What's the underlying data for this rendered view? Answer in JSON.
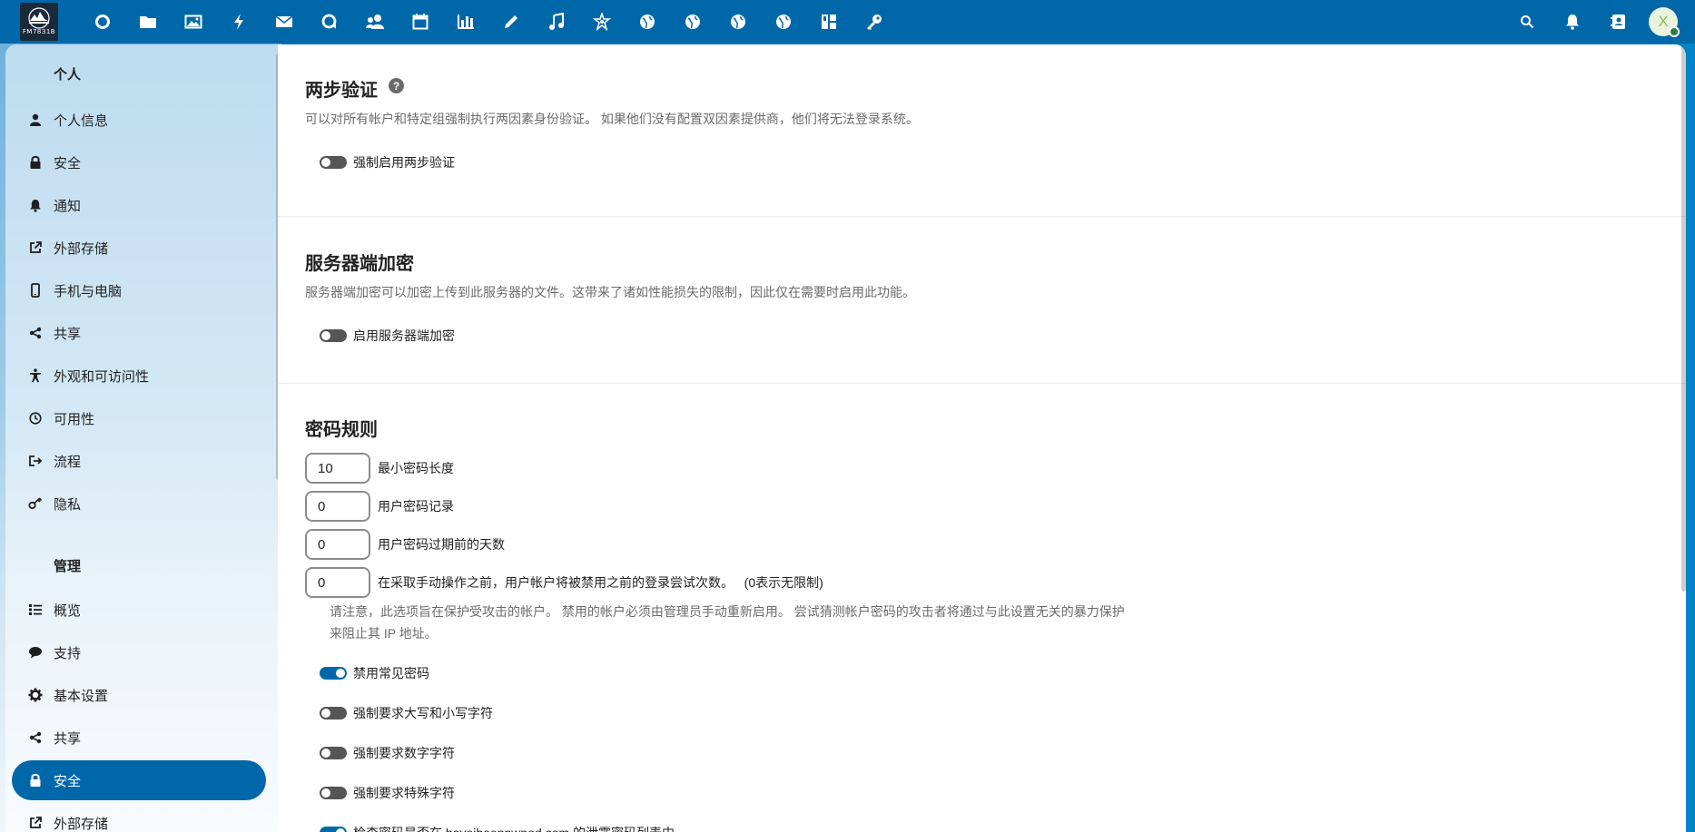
{
  "logo": {
    "text": "FM7831B"
  },
  "topbar": {
    "apps": [
      {
        "icon": "dashboard-icon",
        "glyph": "circle"
      },
      {
        "icon": "files-icon",
        "glyph": "folder"
      },
      {
        "icon": "photos-icon",
        "glyph": "image"
      },
      {
        "icon": "activity-icon",
        "glyph": "bolt"
      },
      {
        "icon": "mail-icon",
        "glyph": "mail"
      },
      {
        "icon": "talk-icon",
        "glyph": "chat"
      },
      {
        "icon": "contacts-icon",
        "glyph": "people"
      },
      {
        "icon": "calendar-icon",
        "glyph": "calendar"
      },
      {
        "icon": "analytics-icon",
        "glyph": "bars"
      },
      {
        "icon": "notes-icon",
        "glyph": "pencil"
      },
      {
        "icon": "music-icon",
        "glyph": "note"
      },
      {
        "icon": "cospend-icon",
        "glyph": "star"
      },
      {
        "icon": "external-site-1-icon",
        "glyph": "globe"
      },
      {
        "icon": "external-site-2-icon",
        "glyph": "globe"
      },
      {
        "icon": "external-site-3-icon",
        "glyph": "globe"
      },
      {
        "icon": "external-site-4-icon",
        "glyph": "globe"
      },
      {
        "icon": "deck-icon",
        "glyph": "board"
      },
      {
        "icon": "passwords-icon",
        "glyph": "key"
      }
    ],
    "avatar_letter": "X"
  },
  "sidebar": {
    "personal_title": "个人",
    "personal": [
      {
        "label": "个人信息",
        "icon": "user-icon"
      },
      {
        "label": "安全",
        "icon": "lock-icon"
      },
      {
        "label": "通知",
        "icon": "bell-icon"
      },
      {
        "label": "外部存储",
        "icon": "external-link-icon"
      },
      {
        "label": "手机与电脑",
        "icon": "phone-icon"
      },
      {
        "label": "共享",
        "icon": "share-icon"
      },
      {
        "label": "外观和可访问性",
        "icon": "accessibility-icon"
      },
      {
        "label": "可用性",
        "icon": "clock-icon"
      },
      {
        "label": "流程",
        "icon": "flow-icon"
      },
      {
        "label": "隐私",
        "icon": "key-icon"
      }
    ],
    "admin_title": "管理",
    "admin": [
      {
        "label": "概览",
        "icon": "list-icon"
      },
      {
        "label": "支持",
        "icon": "chat-bubble-icon"
      },
      {
        "label": "基本设置",
        "icon": "gear-icon"
      },
      {
        "label": "共享",
        "icon": "share-icon"
      },
      {
        "label": "安全",
        "icon": "lock-icon",
        "active": true
      },
      {
        "label": "外部存储",
        "icon": "external-link-icon"
      }
    ]
  },
  "two_factor": {
    "title": "两步验证",
    "description": "可以对所有帐户和特定组强制执行两因素身份验证。 如果他们没有配置双因素提供商，他们将无法登录系统。",
    "toggle_label": "强制启用两步验证",
    "enabled": false
  },
  "encryption": {
    "title": "服务器端加密",
    "description": "服务器端加密可以加密上传到此服务器的文件。这带来了诸如性能损失的限制，因此仅在需要时启用此功能。",
    "toggle_label": "启用服务器端加密",
    "enabled": false
  },
  "password_policy": {
    "title": "密码规则",
    "fields": [
      {
        "value": "10",
        "label": "最小密码长度"
      },
      {
        "value": "0",
        "label": "用户密码记录"
      },
      {
        "value": "0",
        "label": "用户密码过期前的天数"
      },
      {
        "value": "0",
        "label": "在采取手动操作之前，用户帐户将被禁用之前的登录尝试次数。   (0表示无限制)"
      }
    ],
    "note": "请注意，此选项旨在保护受攻击的帐户。 禁用的帐户必须由管理员手动重新启用。 尝试猜测帐户密码的攻击者将通过与此设置无关的暴力保护来阻止其 IP 地址。",
    "toggles": [
      {
        "label": "禁用常见密码",
        "enabled": true
      },
      {
        "label": "强制要求大写和小写字符",
        "enabled": false
      },
      {
        "label": "强制要求数字字符",
        "enabled": false
      },
      {
        "label": "强制要求特殊字符",
        "enabled": false
      },
      {
        "label": "检查密码是否在 haveibeenpwned.com 的泄露密码列表中",
        "enabled": true
      }
    ]
  }
}
